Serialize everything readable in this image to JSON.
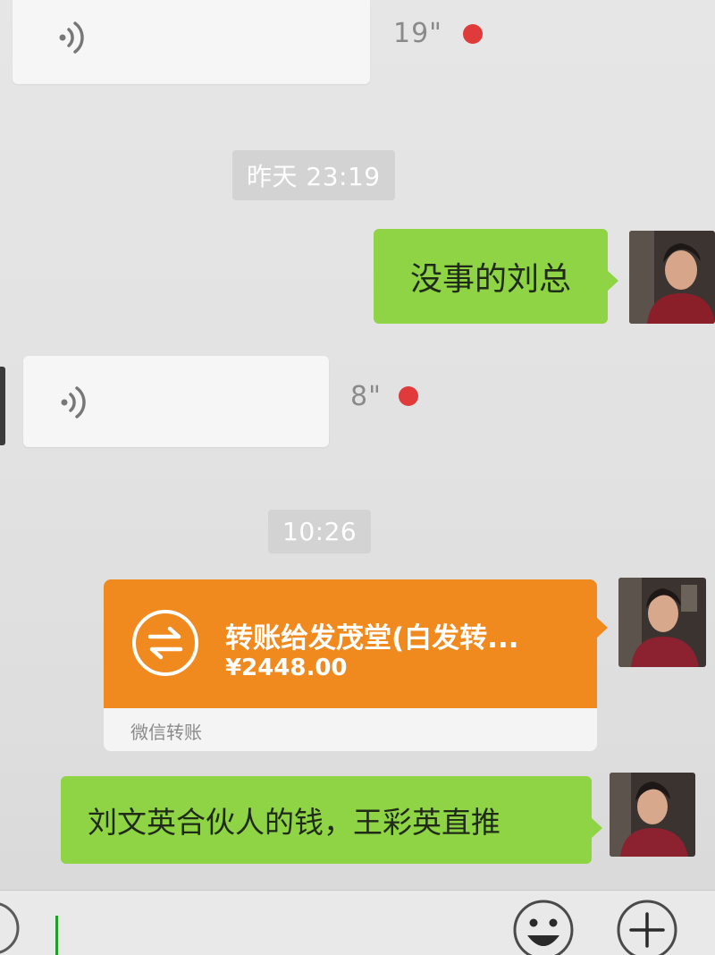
{
  "conversation": {
    "messages": [
      {
        "type": "voice",
        "direction": "received",
        "duration": "19\"",
        "unread": true,
        "icon": "voice-wave-icon"
      },
      {
        "type": "timestamp",
        "text": "昨天 23:19"
      },
      {
        "type": "text",
        "direction": "sent",
        "text": "没事的刘总"
      },
      {
        "type": "voice",
        "direction": "received",
        "duration": "8\"",
        "unread": true,
        "icon": "voice-wave-icon"
      },
      {
        "type": "timestamp",
        "text": "10:26"
      },
      {
        "type": "transfer",
        "direction": "sent",
        "title": "转账给发茂堂(白发转...",
        "amount": "¥2448.00",
        "footer": "微信转账",
        "icon": "transfer-arrows-icon"
      },
      {
        "type": "text",
        "direction": "sent",
        "text": "刘文英合伙人的钱，王彩英直推"
      }
    ]
  },
  "input_bar": {
    "icons": [
      "voice-toggle-icon",
      "emoji-icon",
      "plus-icon"
    ]
  },
  "colors": {
    "sent_bubble": "#8ed445",
    "transfer_card": "#f08a1e",
    "unread_dot": "#e03a3a",
    "received_bubble": "#f6f6f6"
  }
}
